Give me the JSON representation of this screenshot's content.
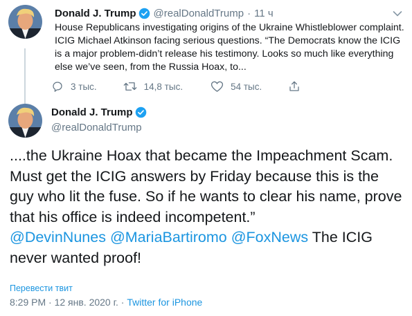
{
  "colors": {
    "accent": "#1b95e0",
    "muted": "#657786",
    "text": "#14171a",
    "line": "#ccd6dd"
  },
  "tweet1": {
    "name": "Donald J. Trump",
    "handle": "@realDonaldTrump",
    "time": "11 ч",
    "icons": {
      "verified": "verified-badge-icon",
      "caret": "chevron-down-icon"
    },
    "text": "House Republicans investigating origins of the Ukraine Whistleblower complaint. ICIG Michael Atkinson facing serious questions. “The Democrats know the ICIG is a major problem-didn’t release his testimony. Looks so much like everything else we’ve seen, from the Russia Hoax, to...",
    "actions": {
      "reply": "3 тыс.",
      "retweet": "14,8 тыс.",
      "like": "54 тыс."
    }
  },
  "tweet2": {
    "name": "Donald J. Trump",
    "handle": "@realDonaldTrump",
    "text_part1": "....the Ukraine Hoax that became the Impeachment Scam. Must get the ICIG answers by Friday because this is the guy who lit the fuse. So if he wants to clear his name, prove that his office is indeed incompetent.”",
    "mentions": [
      "@DevinNunes",
      "@MariaBartiromo",
      "@FoxNews"
    ],
    "text_part2": "The ICIG never wanted proof!",
    "translate": "Перевести твит",
    "timestamp": "8:29 PM · 12 янв. 2020 г.",
    "separator": "·",
    "source": "Twitter for iPhone"
  }
}
